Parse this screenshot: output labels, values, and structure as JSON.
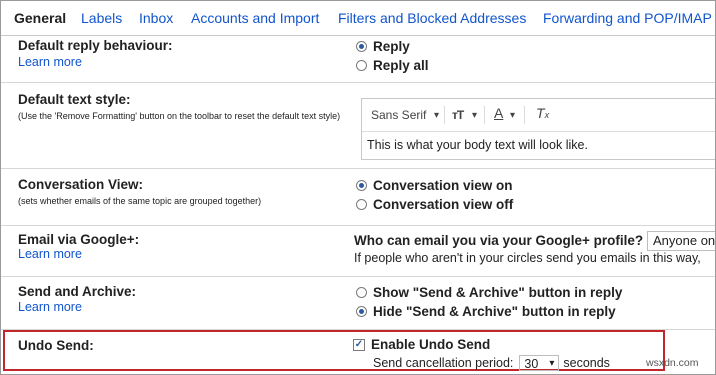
{
  "tabs": [
    "General",
    "Labels",
    "Inbox",
    "Accounts and Import",
    "Filters and Blocked Addresses",
    "Forwarding and POP/IMAP"
  ],
  "reply": {
    "label": "Default reply behaviour:",
    "learn_more": "Learn more",
    "options": [
      "Reply",
      "Reply all"
    ],
    "selected": 0
  },
  "text_style": {
    "label": "Default text style:",
    "hint": "(Use the 'Remove Formatting' button on the toolbar to reset the default text style)",
    "font": "Sans Serif",
    "preview": "This is what your body text will look like."
  },
  "conversation": {
    "label": "Conversation View:",
    "hint": "(sets whether emails of the same topic are grouped together)",
    "options": [
      "Conversation view on",
      "Conversation view off"
    ],
    "selected": 0
  },
  "google_plus": {
    "label": "Email via Google+:",
    "learn_more": "Learn more",
    "question": "Who can email you via your Google+ profile?",
    "select_value": "Anyone on",
    "note": "If people who aren't in your circles send you emails in this way,"
  },
  "send_archive": {
    "label": "Send and Archive:",
    "learn_more": "Learn more",
    "options": [
      "Show \"Send & Archive\" button in reply",
      "Hide \"Send & Archive\" button in reply"
    ],
    "selected": 1
  },
  "undo_send": {
    "label": "Undo Send:",
    "enable_label": "Enable Undo Send",
    "enabled": true,
    "period_label": "Send cancellation period:",
    "period_value": "30",
    "period_unit": "seconds"
  },
  "watermark": "wsxdn.com",
  "colors": {
    "link": "#1155cc",
    "highlight": "#c0272d"
  }
}
